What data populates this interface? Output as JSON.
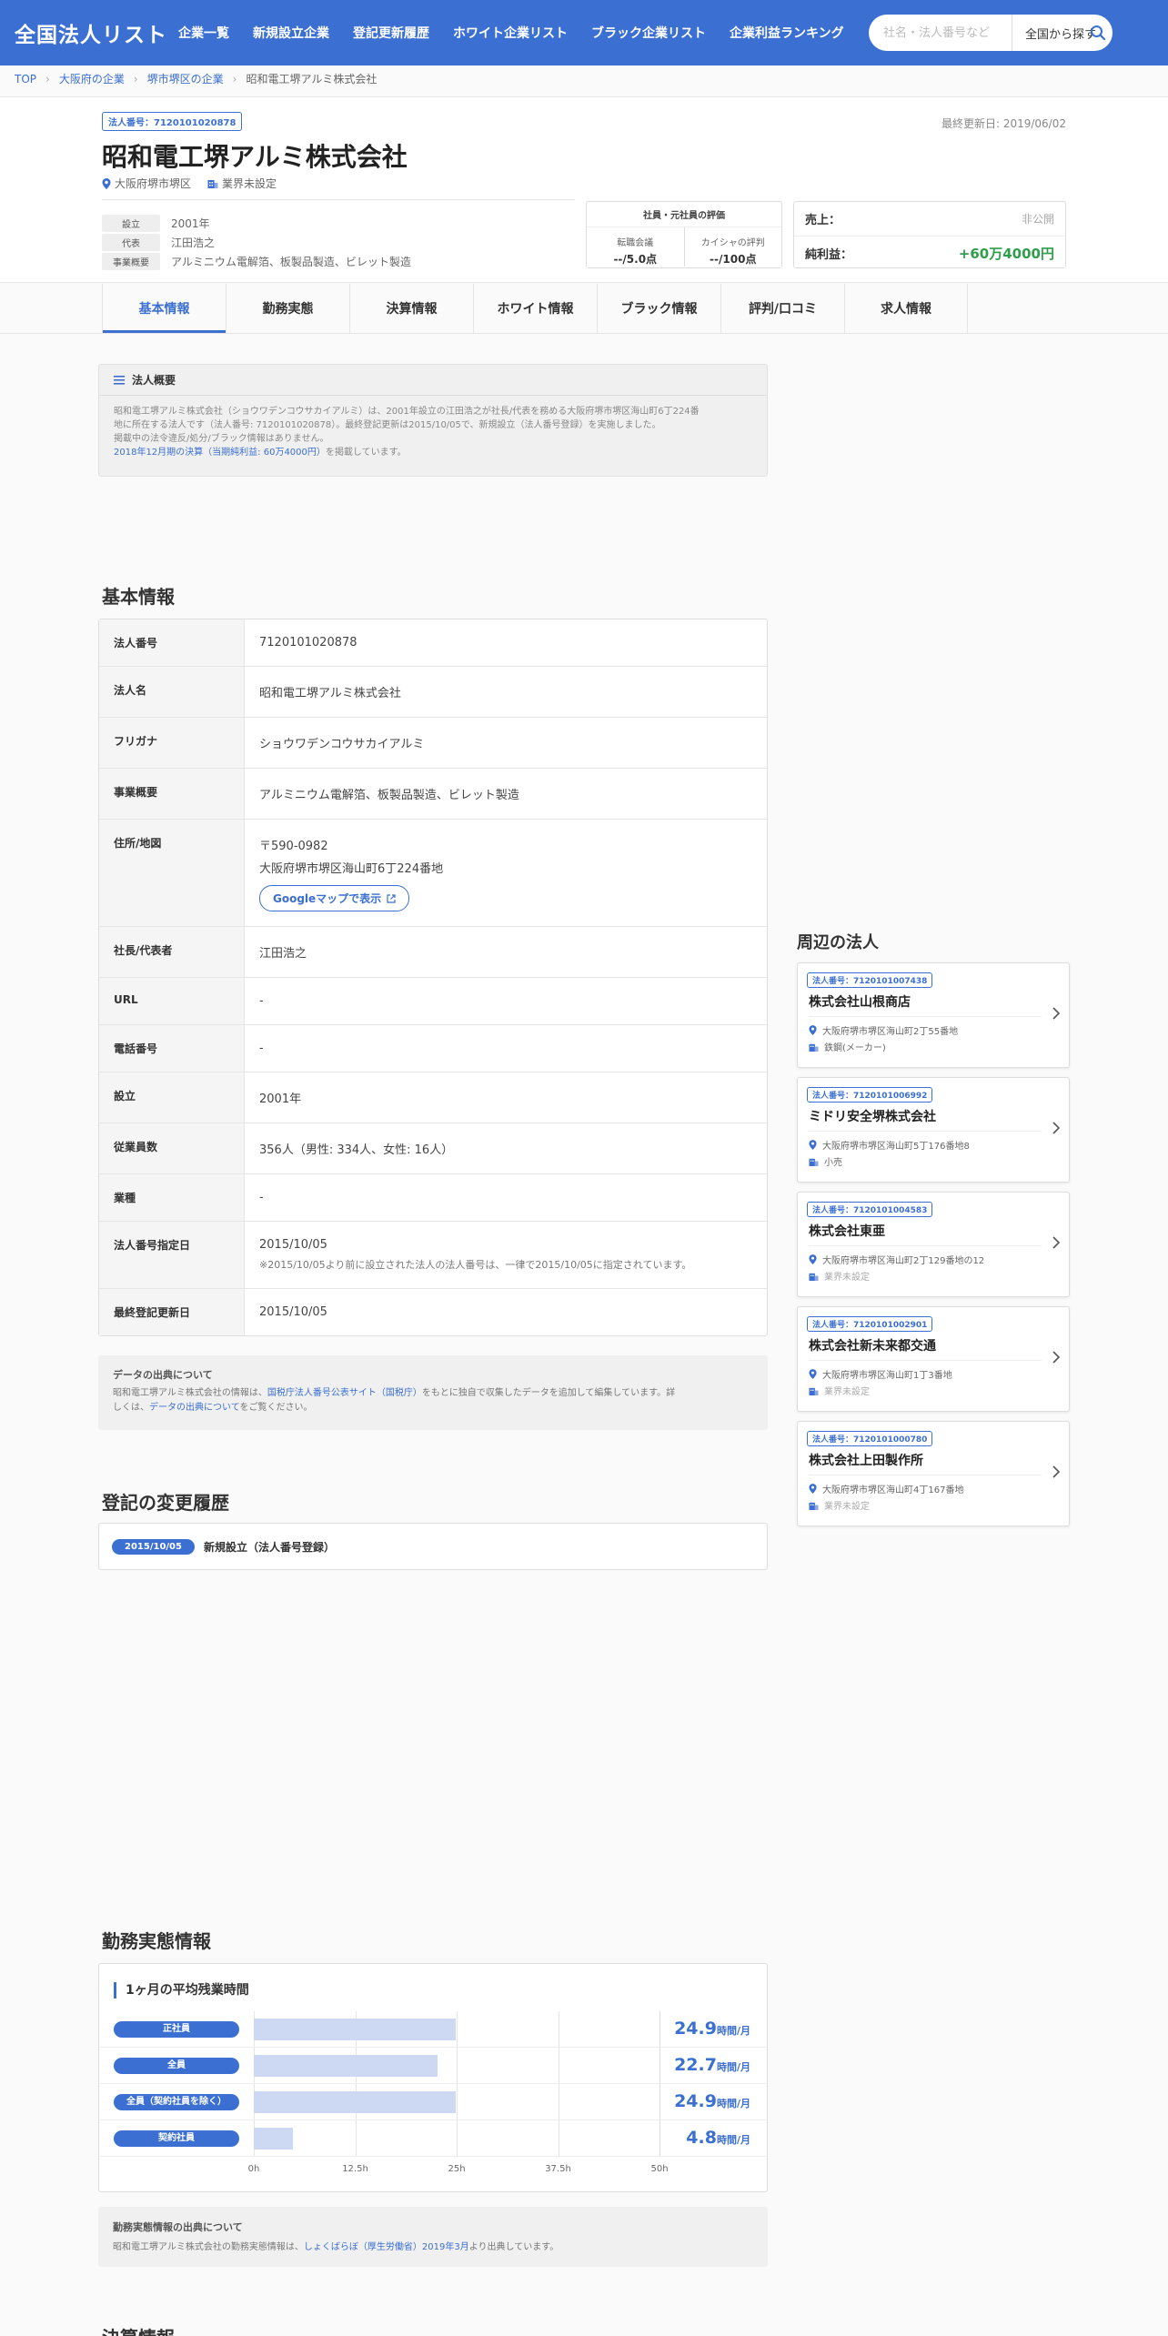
{
  "header": {
    "logo": "全国法人リスト",
    "nav": [
      "企業一覧",
      "新規設立企業",
      "登記更新履歴",
      "ホワイト企業リスト",
      "ブラック企業リスト",
      "企業利益ランキング"
    ],
    "search_placeholder": "社名・法人番号など",
    "search_area": "全国から探す"
  },
  "breadcrumb": [
    "TOP",
    "大阪府の企業",
    "堺市堺区の企業",
    "昭和電工堺アルミ株式会社"
  ],
  "hero": {
    "badge": "法人番号：7120101020878",
    "updated": "最終更新日: 2019/06/02",
    "name": "昭和電工堺アルミ株式会社",
    "location": "大阪府堺市堺区",
    "industry": "業界未設定",
    "facts": [
      {
        "label": "設立",
        "value": "2001年"
      },
      {
        "label": "代表",
        "value": "江田浩之"
      },
      {
        "label": "事業概要",
        "value": "アルミニウム電解箔、板製品製造、ビレット製造"
      }
    ],
    "review_title": "社員・元社員の評価",
    "reviews": [
      {
        "label": "転職会議",
        "value": "--/5.0点"
      },
      {
        "label": "カイシャの評判",
        "value": "--/100点"
      }
    ],
    "sales_label": "売上：",
    "sales_value": "非公開",
    "profit_label": "純利益：",
    "profit_value": "+60万4000円"
  },
  "tabs": [
    "基本情報",
    "勤務実態",
    "決算情報",
    "ホワイト情報",
    "ブラック情報",
    "評判/口コミ",
    "求人情報"
  ],
  "summary": {
    "title": "法人概要",
    "line1": "昭和電工堺アルミ株式会社（ショウワデンコウサカイアルミ）は、2001年設立の江田浩之が社長/代表を務める大阪府堺市堺区海山町6丁224番",
    "line2": "地に所在する法人です（法人番号: 7120101020878）。最終登記更新は2015/10/05で、新規設立（法人番号登録）を実施しました。",
    "line3": "掲載中の法令違反/処分/ブラック情報はありません。",
    "link": "2018年12月期の決算（当期純利益: 60万4000円）",
    "link_suffix": "を掲載しています。"
  },
  "basic": {
    "title": "基本情報",
    "rows": [
      {
        "key": "法人番号",
        "value": "7120101020878"
      },
      {
        "key": "法人名",
        "value": "昭和電工堺アルミ株式会社"
      },
      {
        "key": "フリガナ",
        "value": "ショウワデンコウサカイアルミ"
      },
      {
        "key": "事業概要",
        "value": "アルミニウム電解箔、板製品製造、ビレット製造"
      },
      {
        "key": "住所/地図",
        "value": "〒590-0982",
        "value2": "大阪府堺市堺区海山町6丁224番地",
        "button": "Googleマップで表示"
      },
      {
        "key": "社長/代表者",
        "value": "江田浩之"
      },
      {
        "key": "URL",
        "value": "-"
      },
      {
        "key": "電話番号",
        "value": "-"
      },
      {
        "key": "設立",
        "value": "2001年"
      },
      {
        "key": "従業員数",
        "value": "356人（男性: 334人、女性: 16人）"
      },
      {
        "key": "業種",
        "value": "-"
      },
      {
        "key": "法人番号指定日",
        "value": "2015/10/05",
        "note": "※2015/10/05より前に設立された法人の法人番号は、一律で2015/10/05に指定されています。"
      },
      {
        "key": "最終登記更新日",
        "value": "2015/10/05"
      }
    ]
  },
  "source": {
    "title": "データの出典について",
    "prefix": "昭和電工堺アルミ株式会社の情報は、",
    "link1": "国税庁法人番号公表サイト（国税庁）",
    "middle": "をもとに独自で収集したデータを追加して編集しています。詳",
    "line2_prefix": "しくは、",
    "link2": "データの出典について",
    "line2_suffix": "をご覧ください。"
  },
  "history": {
    "title": "登記の変更履歴",
    "date": "2015/10/05",
    "text": "新規設立（法人番号登録）"
  },
  "nearby": {
    "title": "周辺の法人",
    "cards": [
      {
        "badge": "法人番号：7120101007438",
        "name": "株式会社山根商店",
        "address": "大阪府堺市堺区海山町2丁55番地",
        "industry": "鉄鋼(メーカー)",
        "unset": false
      },
      {
        "badge": "法人番号：7120101006992",
        "name": "ミドリ安全堺株式会社",
        "address": "大阪府堺市堺区海山町5丁176番地8",
        "industry": "小売",
        "unset": false
      },
      {
        "badge": "法人番号：7120101004583",
        "name": "株式会社東亜",
        "address": "大阪府堺市堺区海山町2丁129番地の12",
        "industry": "業界未設定",
        "unset": true
      },
      {
        "badge": "法人番号：7120101002901",
        "name": "株式会社新未来都交通",
        "address": "大阪府堺市堺区海山町1丁3番地",
        "industry": "業界未設定",
        "unset": true
      },
      {
        "badge": "法人番号：7120101000780",
        "name": "株式会社上田製作所",
        "address": "大阪府堺市堺区海山町4丁167番地",
        "industry": "業界未設定",
        "unset": true
      }
    ]
  },
  "work": {
    "title": "勤務実態情報",
    "subtitle": "1ヶ月の平均残業時間",
    "source_title": "勤務実態情報の出典について",
    "source_prefix": "昭和電工堺アルミ株式会社の勤務実態情報は、",
    "source_link": "しょくばらぼ（厚生労働省）2019年3月",
    "source_suffix": "より出典しています。"
  },
  "chart_data": {
    "type": "bar",
    "orientation": "horizontal",
    "categories": [
      "正社員",
      "全員",
      "全員（契約社員を除く）",
      "契約社員"
    ],
    "values": [
      24.9,
      22.7,
      24.9,
      4.8
    ],
    "value_unit": "時間/月",
    "xlim": [
      0,
      50
    ],
    "ticks": [
      "0h",
      "12.5h",
      "25h",
      "37.5h",
      "50h"
    ],
    "grid": true,
    "colors": {
      "bar": "#cdd9f2",
      "label": "#3b6fd1"
    }
  },
  "next_section_title": "決算情報",
  "colors": {
    "brand": "#3b6fd1",
    "profit": "#2e9e4a"
  }
}
